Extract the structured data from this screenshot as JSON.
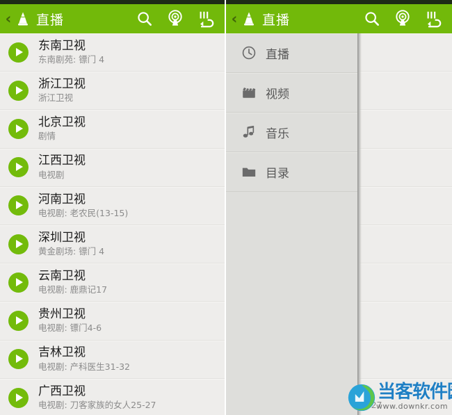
{
  "app": {
    "title": "直播",
    "accent_color": "#72b90a",
    "statusbar_color": "#1d2b16",
    "list_bg_color": "#eeedeb",
    "drawer_bg_color": "#dededb"
  },
  "actionbar": {
    "back_glyph": "‹",
    "logo_name": "vlc-cone-logo",
    "title": "直播",
    "icons": [
      {
        "name": "search-icon",
        "label": "搜索"
      },
      {
        "name": "stream-antenna-icon",
        "label": "网络串流"
      },
      {
        "name": "audio-delay-icon",
        "label": "音频延迟"
      }
    ]
  },
  "drawer": {
    "items": [
      {
        "icon": "clock-icon",
        "label": "直播"
      },
      {
        "icon": "clapperboard-icon",
        "label": "视频"
      },
      {
        "icon": "music-note-icon",
        "label": "音乐"
      },
      {
        "icon": "folder-icon",
        "label": "目录"
      }
    ]
  },
  "channels": [
    {
      "title": "东南卫视",
      "subtitle": "东南剧苑: 镖门 4"
    },
    {
      "title": "浙江卫视",
      "subtitle": "浙江卫视"
    },
    {
      "title": "北京卫视",
      "subtitle": "剧情"
    },
    {
      "title": "江西卫视",
      "subtitle": "电视剧"
    },
    {
      "title": "河南卫视",
      "subtitle": "电视剧: 老农民(13-15)"
    },
    {
      "title": "深圳卫视",
      "subtitle": "黄金剧场: 镖门 4"
    },
    {
      "title": "云南卫视",
      "subtitle": "电视剧: 鹿鼎记17"
    },
    {
      "title": "贵州卫视",
      "subtitle": "电视剧: 镖门4-6"
    },
    {
      "title": "吉林卫视",
      "subtitle": "电视剧: 产科医生31-32"
    },
    {
      "title": "广西卫视",
      "subtitle": "电视剧: 刀客家族的女人25-27"
    }
  ],
  "watermark": {
    "name": "当客软件园",
    "url": "www.downkr.com"
  }
}
